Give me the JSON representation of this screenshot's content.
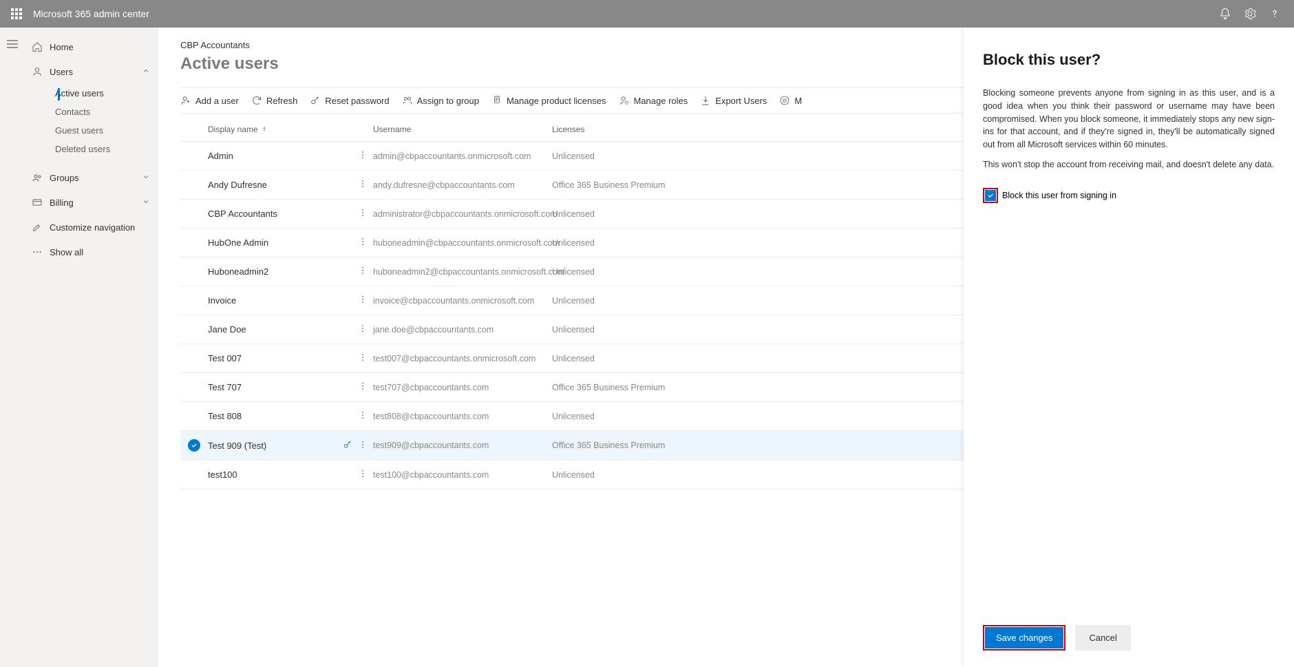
{
  "topbar": {
    "title": "Microsoft 365 admin center"
  },
  "sidebar": {
    "home": "Home",
    "users": "Users",
    "users_children": {
      "active": "Active users",
      "contacts": "Contacts",
      "guest": "Guest users",
      "deleted": "Deleted users"
    },
    "groups": "Groups",
    "billing": "Billing",
    "customize": "Customize navigation",
    "showall": "Show all"
  },
  "main": {
    "org": "CBP Accountants",
    "page_title": "Active users"
  },
  "cmdbar": {
    "add": "Add a user",
    "refresh": "Refresh",
    "reset": "Reset password",
    "assign": "Assign to group",
    "manage_lic": "Manage product licenses",
    "manage_roles": "Manage roles",
    "export": "Export Users",
    "more_prefix": "M"
  },
  "table": {
    "headers": {
      "display": "Display name",
      "username": "Username",
      "licenses": "Licenses"
    },
    "rows": [
      {
        "display": "Admin",
        "username": "admin@cbpaccountants.onmicrosoft.com",
        "license": "Unlicensed",
        "selected": false
      },
      {
        "display": "Andy Dufresne",
        "username": "andy.dufresne@cbpaccountants.com",
        "license": "Office 365 Business Premium",
        "selected": false
      },
      {
        "display": "CBP Accountants",
        "username": "administrator@cbpaccountants.onmicrosoft.com",
        "license": "Unlicensed",
        "selected": false
      },
      {
        "display": "HubOne Admin",
        "username": "huboneadmin@cbpaccountants.onmicrosoft.com",
        "license": "Unlicensed",
        "selected": false
      },
      {
        "display": "Huboneadmin2",
        "username": "huboneadmin2@cbpaccountants.onmicrosoft.com",
        "license": "Unlicensed",
        "selected": false
      },
      {
        "display": "Invoice",
        "username": "invoice@cbpaccountants.onmicrosoft.com",
        "license": "Unlicensed",
        "selected": false
      },
      {
        "display": "Jane Doe",
        "username": "jane.doe@cbpaccountants.com",
        "license": "Unlicensed",
        "selected": false
      },
      {
        "display": "Test 007",
        "username": "test007@cbpaccountants.onmicrosoft.com",
        "license": "Unlicensed",
        "selected": false
      },
      {
        "display": "Test 707",
        "username": "test707@cbpaccountants.com",
        "license": "Office 365 Business Premium",
        "selected": false
      },
      {
        "display": "Test 808",
        "username": "test808@cbpaccountants.com",
        "license": "Unlicensed",
        "selected": false
      },
      {
        "display": "Test 909 (Test)",
        "username": "test909@cbpaccountants.com",
        "license": "Office 365 Business Premium",
        "selected": true
      },
      {
        "display": "test100",
        "username": "test100@cbpaccountants.com",
        "license": "Unlicensed",
        "selected": false
      }
    ]
  },
  "panel": {
    "title": "Block this user?",
    "p1": "Blocking someone prevents anyone from signing in as this user, and is a good idea when you think their password or username may have been compromised. When you block someone, it immediately stops any new sign-ins for that account, and if they're signed in, they'll be automatically signed out from all Microsoft services within 60 minutes.",
    "p2": "This won't stop the account from receiving mail, and doesn't delete any data.",
    "checkbox_label": "Block this user from signing in",
    "save": "Save changes",
    "cancel": "Cancel"
  }
}
